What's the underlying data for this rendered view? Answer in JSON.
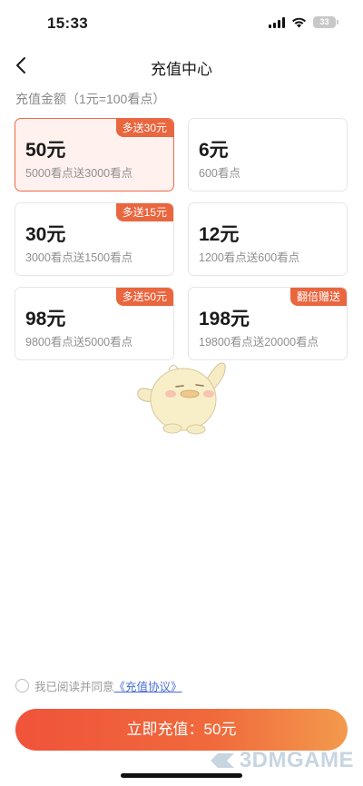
{
  "status_bar": {
    "time": "15:33",
    "battery": "33"
  },
  "nav": {
    "title": "充值中心"
  },
  "section": {
    "title": "充值金额（1元=100看点）"
  },
  "options": [
    {
      "amount": "50元",
      "desc": "5000看点送3000看点",
      "badge": "多送30元",
      "selected": true
    },
    {
      "amount": "6元",
      "desc": "600看点",
      "badge": "",
      "selected": false
    },
    {
      "amount": "30元",
      "desc": "3000看点送1500看点",
      "badge": "多送15元",
      "selected": false
    },
    {
      "amount": "12元",
      "desc": "1200看点送600看点",
      "badge": "",
      "selected": false
    },
    {
      "amount": "98元",
      "desc": "9800看点送5000看点",
      "badge": "多送50元",
      "selected": false
    },
    {
      "amount": "198元",
      "desc": "19800看点送20000看点",
      "badge": "翻倍赠送",
      "selected": false
    }
  ],
  "agreement": {
    "text": "我已阅读并同意",
    "link": "《充值协议》"
  },
  "pay_button": {
    "label": "立即充值：50元"
  },
  "watermark": {
    "text": "3DMGAME"
  },
  "colors": {
    "accent": "#e9663f",
    "selected_bg": "#fff1ee",
    "link": "#4a6fd6"
  }
}
